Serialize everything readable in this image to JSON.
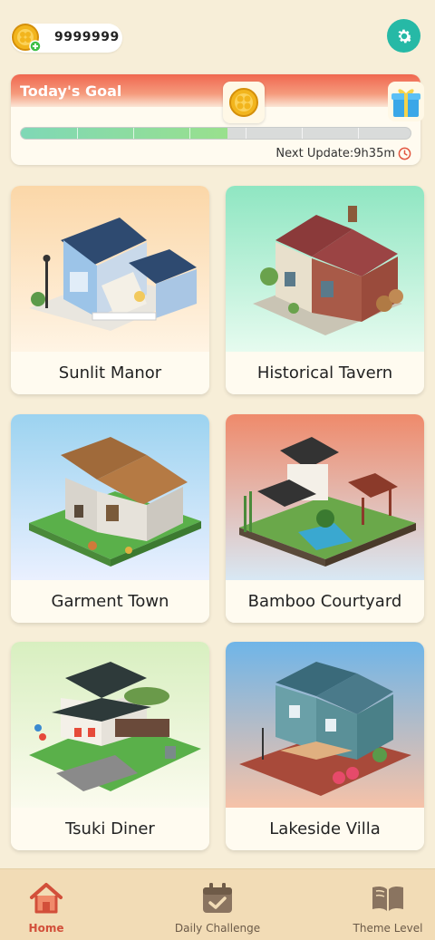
{
  "header": {
    "coin_amount": "9999999",
    "coin_icon": "gold-coin-plus-icon",
    "settings_icon": "gear-icon"
  },
  "goal": {
    "title": "Today's Goal",
    "progress": 0.53,
    "next_update_label": "Next Update:9h35m",
    "reward_icon": "gold-coin-icon",
    "gift_icon": "gift-box-icon"
  },
  "themes": [
    {
      "name": "Sunlit Manor",
      "bg_top": "#fbd7a8",
      "bg_bottom": "#fff4e4"
    },
    {
      "name": "Historical Tavern",
      "bg_top": "#8fe6c2",
      "bg_bottom": "#e6fbef"
    },
    {
      "name": "Garment Town",
      "bg_top": "#9cd3f0",
      "bg_bottom": "#eaf0ff"
    },
    {
      "name": "Bamboo Courtyard",
      "bg_top": "#ef8a6b",
      "bg_bottom": "#d8e8f4"
    },
    {
      "name": "Tsuki Diner",
      "bg_top": "#d8efc0",
      "bg_bottom": "#fbfbee"
    },
    {
      "name": "Lakeside Villa",
      "bg_top": "#6fb5e8",
      "bg_bottom": "#f6c2a8"
    }
  ],
  "nav": {
    "home": "Home",
    "daily": "Daily Challenge",
    "theme": "Theme Level"
  },
  "colors": {
    "accent": "#26b9a6",
    "active_nav": "#d24f3a",
    "background": "#f7eed8"
  }
}
